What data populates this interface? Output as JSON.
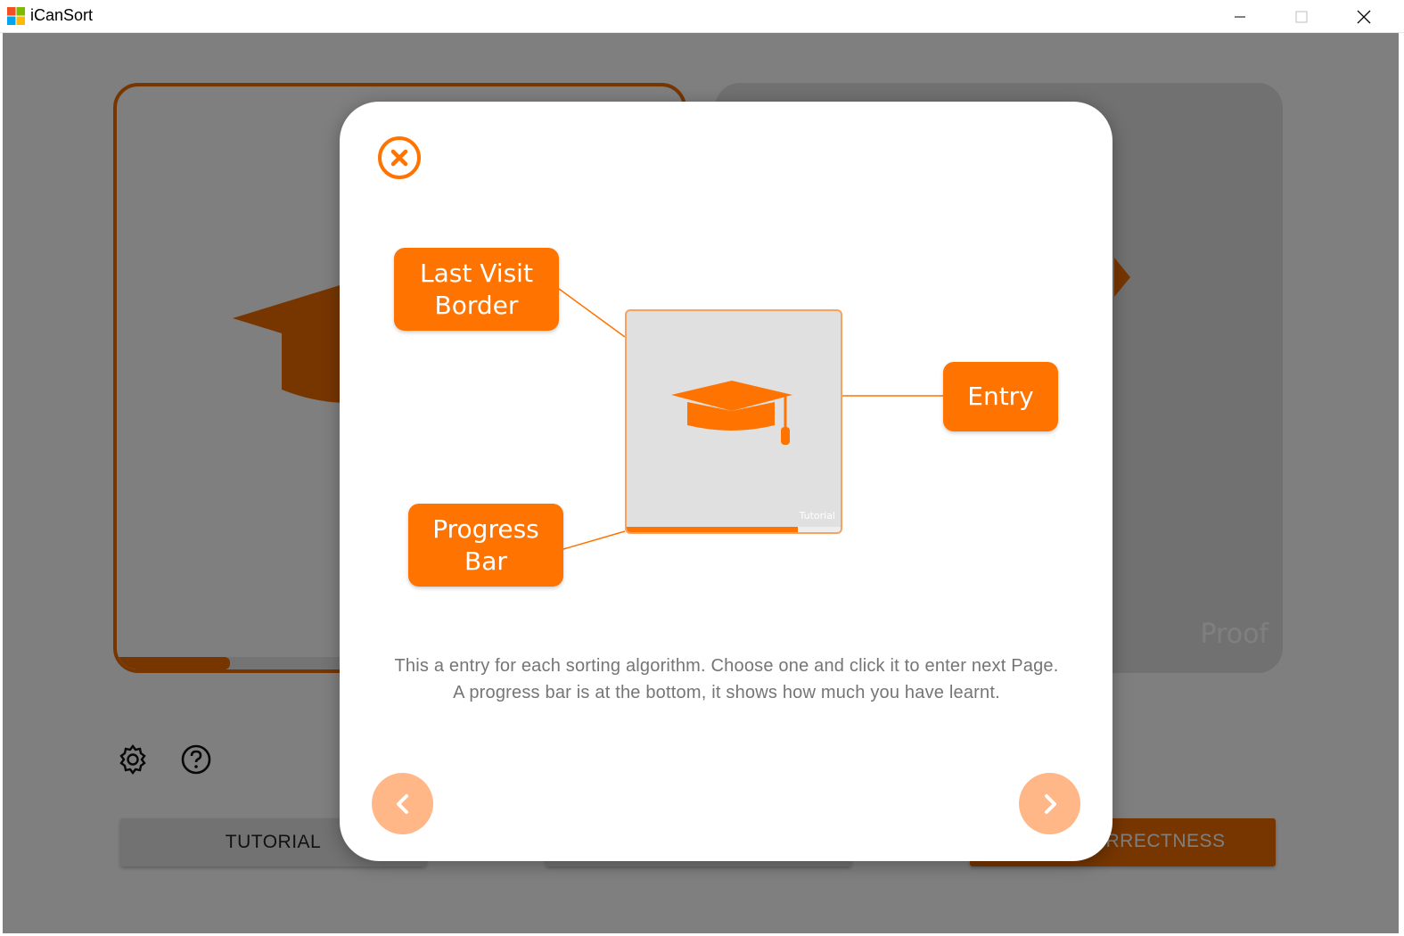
{
  "window": {
    "title": "iCanSort",
    "logo_colors": [
      "#f25022",
      "#7fba00",
      "#00a4ef",
      "#ffb900"
    ]
  },
  "background": {
    "card_right_label": "Proof",
    "left_card_progress": 0.2,
    "buttons": {
      "tutorial_label": "TUTORIAL",
      "middle_label": "",
      "correctness_label": "CORRECTNESS"
    },
    "icons": {
      "settings": "gear-icon",
      "help": "help-icon"
    }
  },
  "modal": {
    "callouts": {
      "last_visit_border": "Last Visit\nBorder",
      "progress_bar": "Progress\nBar",
      "entry": "Entry"
    },
    "preview_label": "Tutorial",
    "preview_progress": 0.8,
    "description": "This a entry for each sorting algorithm. Choose one and click it to enter next Page. A progress bar is at the bottom, it shows how much you have learnt.",
    "icons": {
      "close": "close-icon",
      "prev": "chevron-left-icon",
      "next": "chevron-right-icon"
    }
  },
  "colors": {
    "accent": "#ff7300",
    "accent_light": "#ffb787",
    "text_muted": "#757575"
  }
}
